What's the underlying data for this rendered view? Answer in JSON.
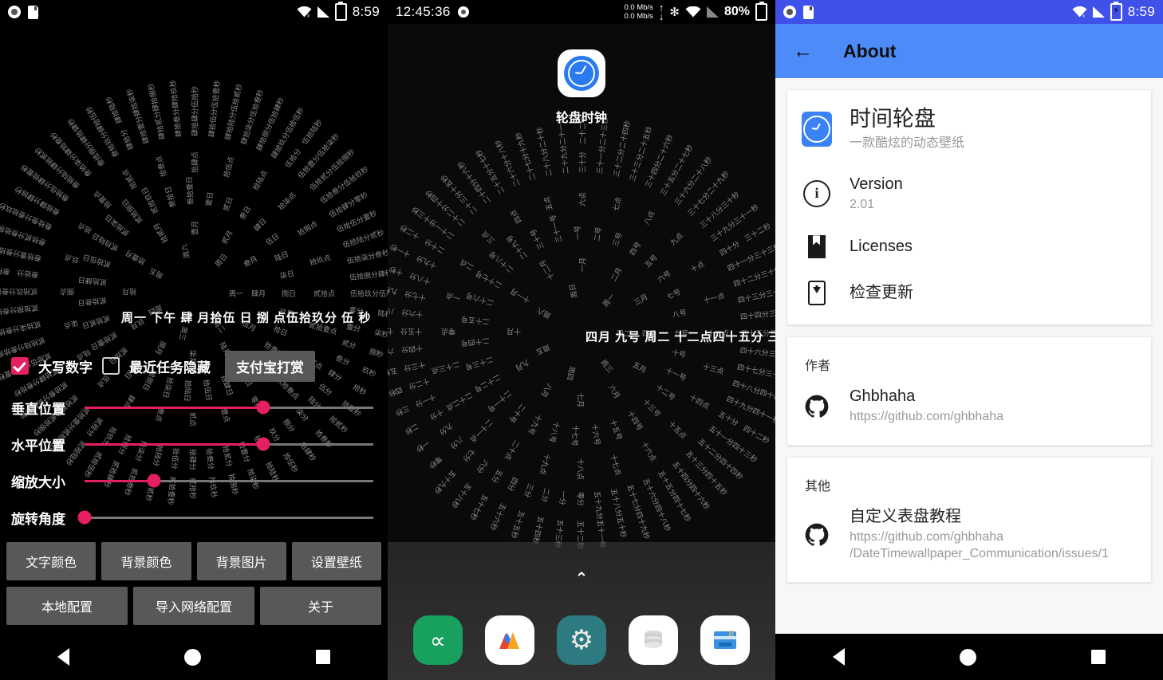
{
  "panel1": {
    "statusbar": {
      "icons_left": [
        "screen-record-icon",
        "sd-card-icon"
      ],
      "icons_right": [
        "wifi-off-icon",
        "signal-icon",
        "battery-charging-icon"
      ],
      "time": "8:59"
    },
    "clock": {
      "center_text": "周一 下午 肆 月拾伍 日 捌 点伍拾玖分 伍 秒",
      "center_weekday": "周一",
      "center_ampm": "下午",
      "ring_unit_labels": [
        "月",
        "日",
        "点",
        "分",
        "秒"
      ],
      "numerals": [
        "零",
        "壹",
        "贰",
        "叁",
        "肆",
        "伍",
        "陆",
        "柒",
        "捌",
        "玖",
        "拾"
      ]
    },
    "checkboxes": [
      {
        "label": "大写数字",
        "checked": true
      },
      {
        "label": "最近任务隐藏",
        "checked": false
      }
    ],
    "donate_button": "支付宝打赏",
    "sliders": [
      {
        "label": "垂直位置",
        "value": 62
      },
      {
        "label": "水平位置",
        "value": 62
      },
      {
        "label": "缩放大小",
        "value": 24
      },
      {
        "label": "旋转角度",
        "value": 0
      }
    ],
    "buttons_row1": [
      "文字颜色",
      "背景颜色",
      "背景图片",
      "设置壁纸"
    ],
    "buttons_row2": [
      "本地配置",
      "导入网络配置",
      "关于"
    ],
    "navbar": [
      "back-button",
      "home-button",
      "recents-button"
    ]
  },
  "panel2": {
    "statusbar": {
      "time": "12:45:36",
      "record_icon": "screen-record-icon",
      "net_up": "0.0 Mb/s",
      "net_down": "0.0 Mb/s",
      "icons": [
        "bluetooth-icon",
        "wifi-icon",
        "signal-off-icon"
      ],
      "battery": "80%"
    },
    "app": {
      "name": "轮盘时钟",
      "icon": "clock-app-icon"
    },
    "clock": {
      "center_text": "四月 九号 周二 十二点四十五分 三十七秒",
      "month": "四月",
      "day": "九号",
      "weekday": "周二",
      "time_text": "十二点四十五分 三十七秒",
      "numerals": [
        "零",
        "一",
        "二",
        "三",
        "四",
        "五",
        "六",
        "七",
        "八",
        "九",
        "十"
      ],
      "ring_unit_labels": [
        "月",
        "号",
        "点",
        "分",
        "秒"
      ]
    },
    "expand_icon": "chevron-up-icon",
    "dock": [
      {
        "name": "app-icon-green-alpha",
        "glyph": "∝",
        "bg": "#17a05e",
        "fg": "#ffffff"
      },
      {
        "name": "app-icon-markdown",
        "glyph": "M",
        "bg": "#ffffff",
        "fg": "#f5a623"
      },
      {
        "name": "app-icon-settings",
        "glyph": "⚙",
        "bg": "#2d7a80",
        "fg": "#e8e8e8"
      },
      {
        "name": "app-icon-database",
        "glyph": "🗄",
        "bg": "#ffffff",
        "fg": "#bdbdbd"
      },
      {
        "name": "app-icon-root-explorer",
        "glyph": "R",
        "bg": "#ffffff",
        "fg": "#3b90e0"
      }
    ]
  },
  "panel3": {
    "statusbar": {
      "time": "8:59"
    },
    "appbar": {
      "back_icon": "back-arrow-icon",
      "title": "About"
    },
    "app_card": {
      "icon": "clock-app-icon",
      "name": "时间轮盘",
      "tagline": "一款酷炫的动态壁纸",
      "rows": [
        {
          "icon": "info-icon",
          "title": "Version",
          "sub": "2.01"
        },
        {
          "icon": "book-icon",
          "title": "Licenses",
          "sub": ""
        },
        {
          "icon": "phone-download-icon",
          "title": "检查更新",
          "sub": ""
        }
      ]
    },
    "author_card": {
      "title": "作者",
      "rows": [
        {
          "icon": "github-icon",
          "title": "Ghbhaha",
          "sub": "https://github.com/ghbhaha"
        }
      ]
    },
    "other_card": {
      "title": "其他",
      "rows": [
        {
          "icon": "github-icon",
          "title": "自定义表盘教程",
          "sub": "https://github.com/ghbhaha\n/DateTimewallpaper_Communication/issues/1"
        }
      ]
    },
    "navbar": [
      "back-button",
      "home-button",
      "recents-button"
    ]
  },
  "colors": {
    "accent_pink": "#e61e63",
    "appbar_blue": "#4d8bf8",
    "statusbar_blue": "#3f51e8",
    "button_gray": "#585858",
    "panel3_bg": "#f7f7f7"
  }
}
